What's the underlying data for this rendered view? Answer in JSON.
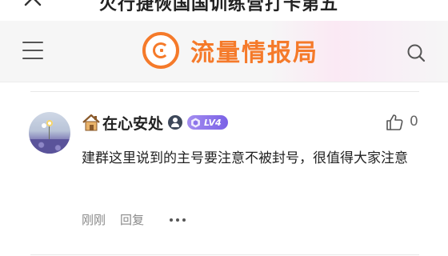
{
  "page": {
    "title": "火行捷恢国国训练营打卡第五"
  },
  "header": {
    "logo_text": "流量情报局",
    "accent": "#f57a2a"
  },
  "comment": {
    "username": "在心安处",
    "level": "LV4",
    "likes": "0",
    "text": "建群这里说到的主号要注意不被封号，很值得大家注意",
    "time": "刚刚",
    "reply_label": "回复"
  },
  "icons": [
    "close-icon",
    "menu-icon",
    "search-icon",
    "house-emoji-icon",
    "verified-user-icon",
    "level-hex-icon",
    "thumbs-up-icon",
    "more-icon"
  ]
}
